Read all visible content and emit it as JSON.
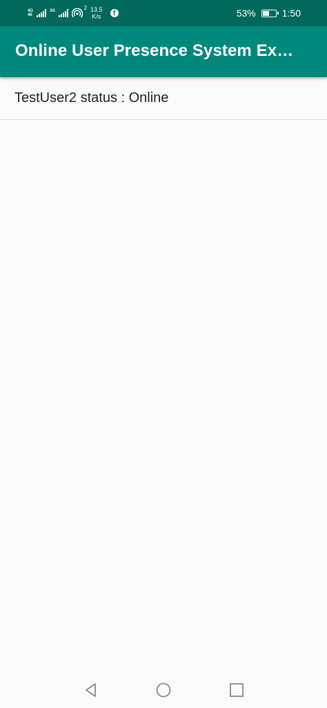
{
  "status_bar": {
    "net1_top": "4G",
    "net1_bottom": "46",
    "net2_top": "3G",
    "hotspot_count": "2",
    "speed_value": "13.5",
    "speed_unit": "K/s",
    "battery_percent": "53%",
    "battery_level": 0.53,
    "time": "1:50"
  },
  "app_bar": {
    "title": "Online User Presence System Example"
  },
  "list": {
    "items": [
      {
        "text": "TestUser2 status : Online"
      }
    ]
  },
  "colors": {
    "status_bar": "#00695c",
    "app_bar": "#00897b",
    "background": "#fafafa"
  },
  "nav_bar": {
    "back_icon": "back-triangle-icon",
    "home_icon": "home-circle-icon",
    "recents_icon": "recents-square-icon"
  }
}
